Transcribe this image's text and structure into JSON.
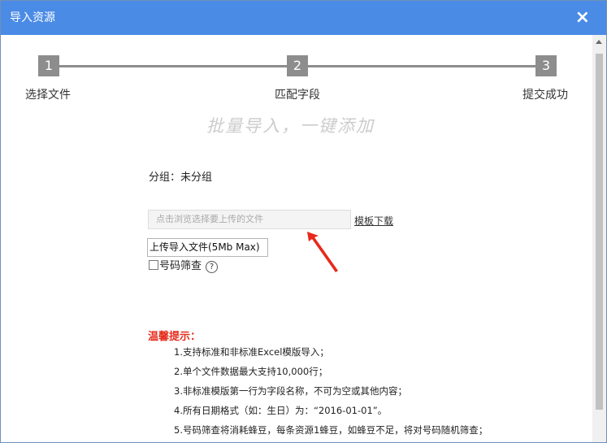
{
  "dialog": {
    "title": "导入资源",
    "close_icon": "×"
  },
  "steps": [
    {
      "num": "1",
      "label": "选择文件"
    },
    {
      "num": "2",
      "label": "匹配字段"
    },
    {
      "num": "3",
      "label": "提交成功"
    }
  ],
  "slogan": "批量导入，一键添加",
  "group_label": "分组：未分组",
  "file_input": {
    "placeholder": "点击浏览选择要上传的文件"
  },
  "template_link": "模板下载",
  "upload_button": "上传导入文件(5Mb Max)",
  "filter": {
    "label": "号码筛查",
    "help": "?"
  },
  "tips": {
    "title": "温馨提示：",
    "items": [
      "1.支持标准和非标准Excel模版导入；",
      "2.单个文件数据最大支持10,000行；",
      "3.非标准模版第一行为字段名称，不可为空或其他内容；",
      "4.所有日期格式（如：生日）为：“2016-01-01”。",
      "5.号码筛查将消耗蜂豆，每条资源1蜂豆，如蜂豆不足，将对号码随机筛查；"
    ]
  },
  "colors": {
    "titlebar": "#4a8be6",
    "step": "#8d8d8d",
    "tip_title": "#e52d1c",
    "arrow": "#e8291b"
  }
}
